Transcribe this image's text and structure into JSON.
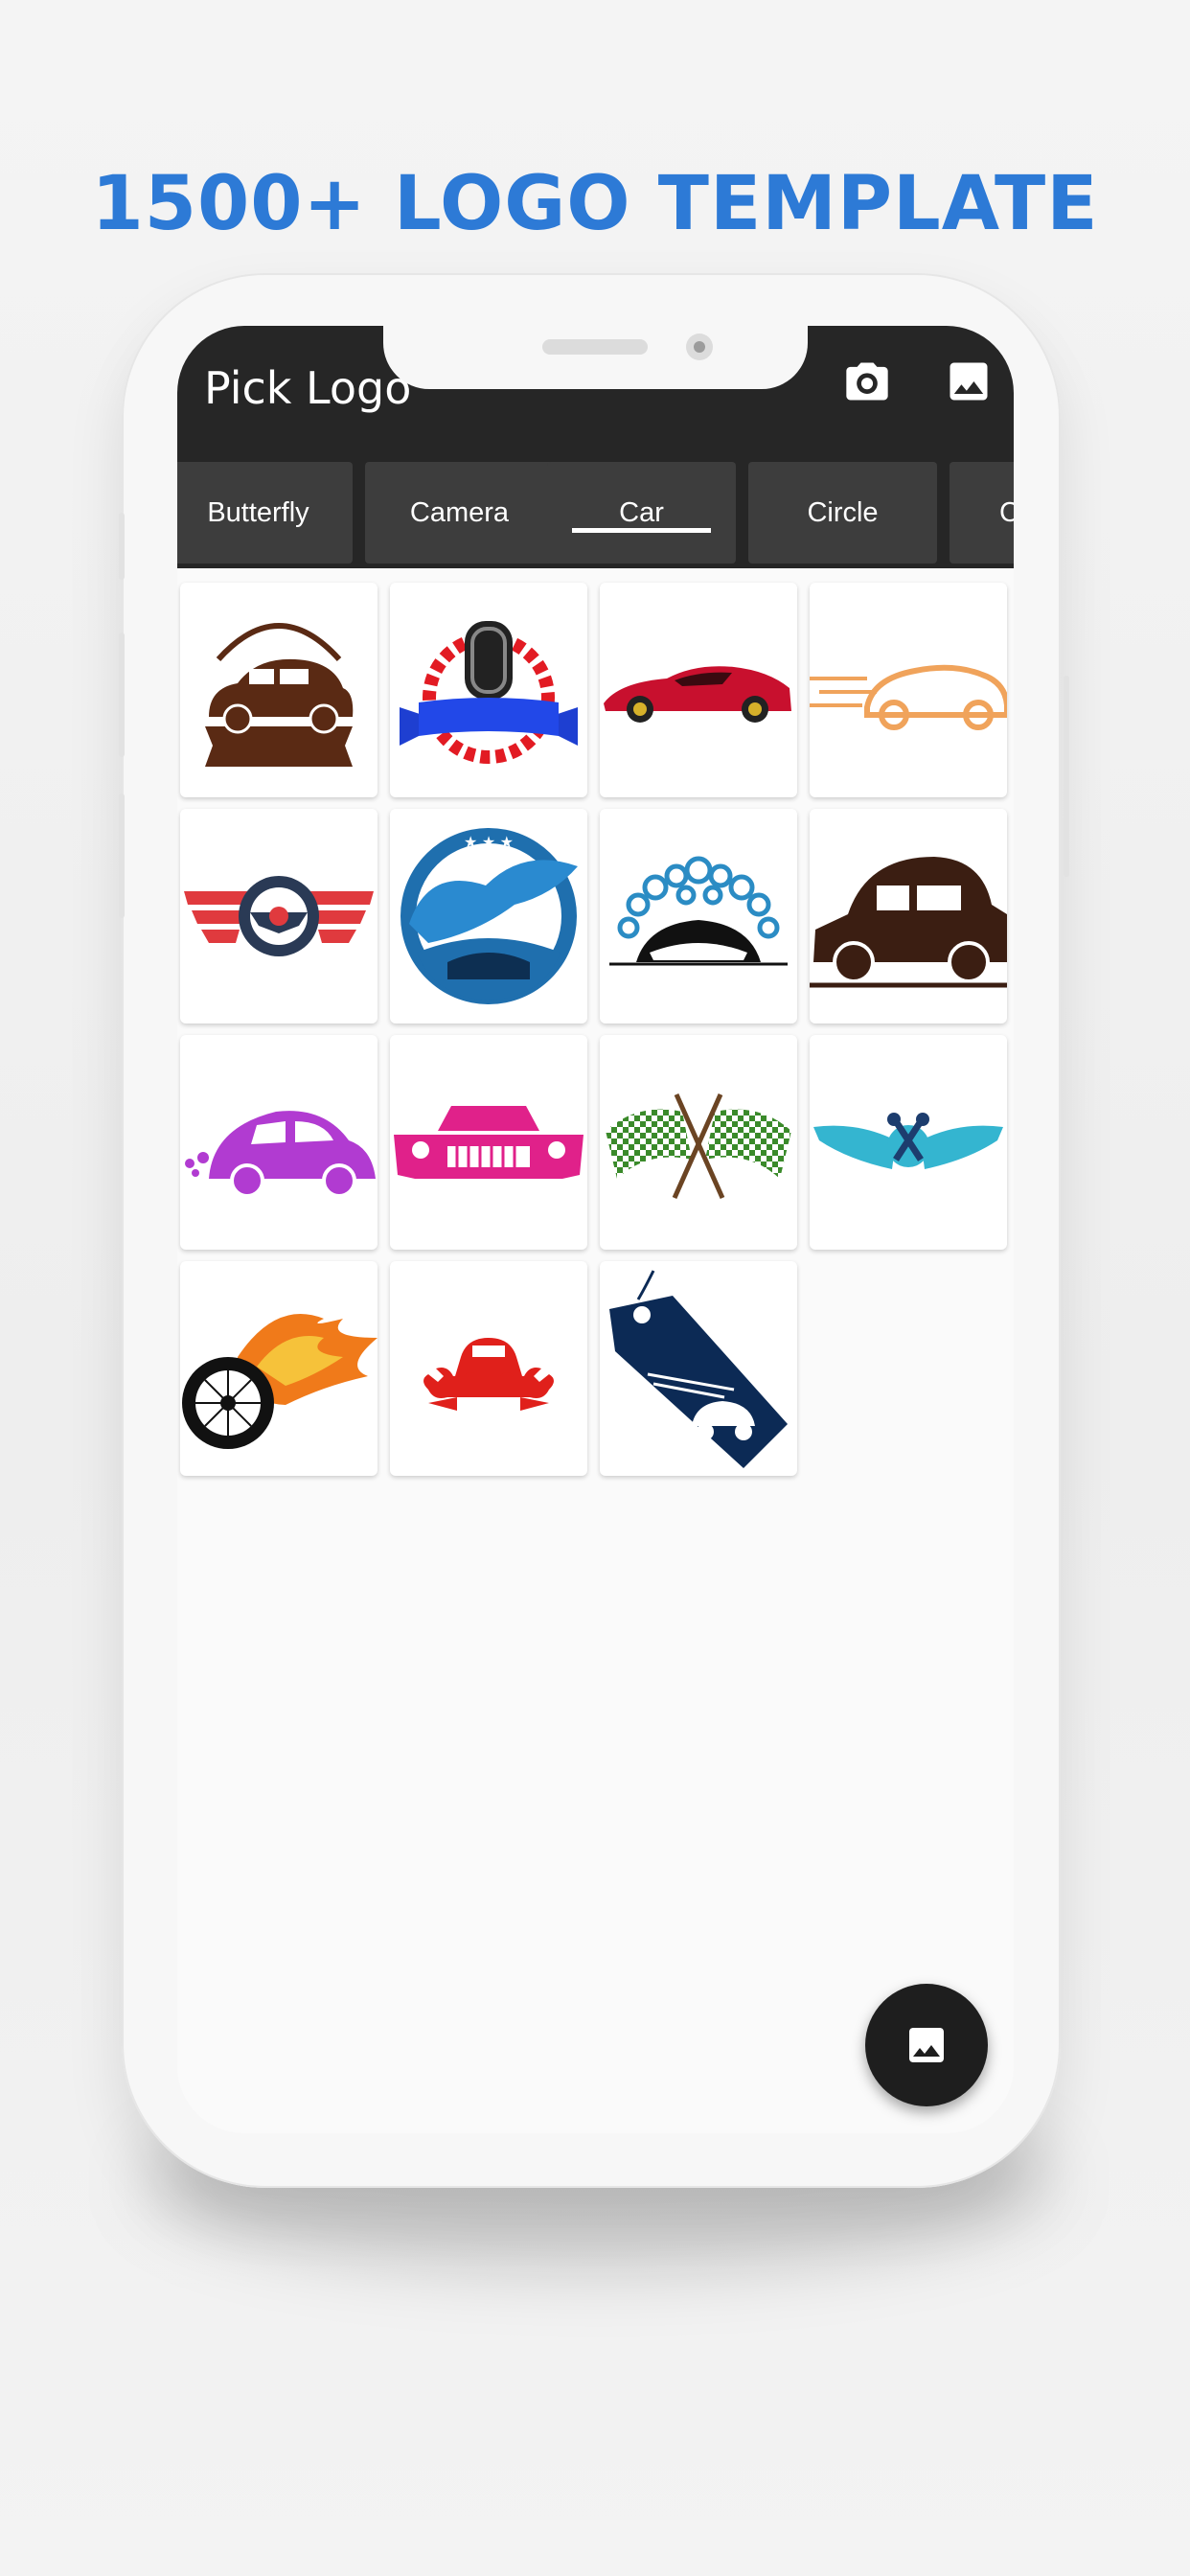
{
  "headline": "1500+ LOGO TEMPLATE",
  "app": {
    "title": "Pick Logo",
    "actions": [
      {
        "name": "camera-button",
        "icon": "camera-icon"
      },
      {
        "name": "gallery-button",
        "icon": "image-icon"
      }
    ]
  },
  "tabs": [
    {
      "label": "Butterfly",
      "selected": false
    },
    {
      "label": "Camera",
      "selected": false
    },
    {
      "label": "Car",
      "selected": true
    },
    {
      "label": "Circle",
      "selected": false
    },
    {
      "label": "C",
      "selected": false
    }
  ],
  "logos": [
    {
      "name": "vintage-beetle-banner-logo",
      "color": "#5a2a14"
    },
    {
      "name": "tire-ribbon-gear-logo",
      "color": "#e21b23"
    },
    {
      "name": "red-sports-car-logo",
      "color": "#c8102e"
    },
    {
      "name": "speeding-orange-car-logo",
      "color": "#f0a35b"
    },
    {
      "name": "steering-wheel-wings-logo",
      "color": "#e03a3e"
    },
    {
      "name": "car-wash-wave-circle-logo",
      "color": "#1f6fae"
    },
    {
      "name": "car-wash-bubbles-logo",
      "color": "#2b8cc4"
    },
    {
      "name": "classic-car-silhouette-logo",
      "color": "#3b1e12"
    },
    {
      "name": "purple-beetle-logo",
      "color": "#b13bd1"
    },
    {
      "name": "pink-muscle-car-logo",
      "color": "#e0218a"
    },
    {
      "name": "checkered-racing-flags-logo",
      "color": "#3a8a2a"
    },
    {
      "name": "winged-pistons-logo",
      "color": "#34b5d0"
    },
    {
      "name": "flaming-wheel-logo",
      "color": "#f07a1a"
    },
    {
      "name": "car-wrench-service-logo",
      "color": "#e0201b"
    },
    {
      "name": "car-price-tag-logo",
      "color": "#0c2a55"
    }
  ],
  "fab": {
    "icon": "image-icon"
  }
}
